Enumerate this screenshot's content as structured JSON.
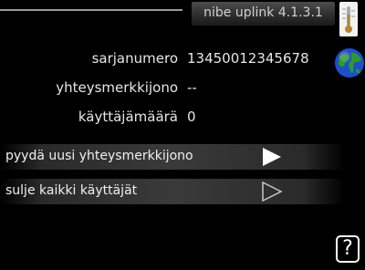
{
  "header": {
    "title": "nibe uplink 4.1.3.1",
    "thermometer_icon": "thermometer-icon"
  },
  "info": {
    "globe_icon": "globe-icon",
    "rows": [
      {
        "label": "sarjanumero",
        "value": "13450012345678"
      },
      {
        "label": "yhteysmerkkijono",
        "value": "--"
      },
      {
        "label": "käyttäjämäärä",
        "value": "0"
      }
    ]
  },
  "actions": [
    {
      "label": "pyydä uusi yhteysmerkkijono",
      "icon": "arrow-right-filled-icon"
    },
    {
      "label": "sulje kaikki käyttäjät",
      "icon": "arrow-right-outline-icon"
    }
  ],
  "help": {
    "label": "?"
  },
  "colors": {
    "background": "#000000",
    "text": "#ffffff",
    "globe_blue": "#2255cc",
    "globe_green": "#2e9a2e"
  }
}
